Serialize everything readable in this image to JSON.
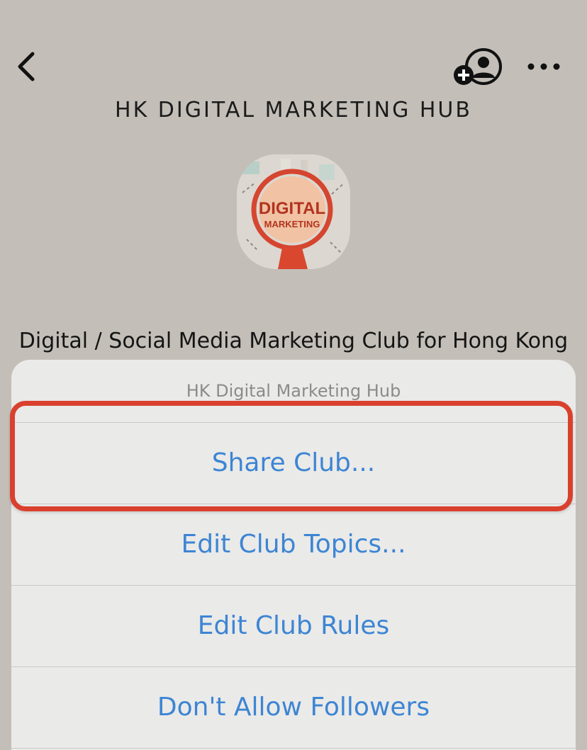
{
  "header": {
    "back_icon": "chevron-left-icon",
    "add_member_icon": "add-person-icon",
    "more_icon": "ellipsis-icon",
    "title": "HK DIGITAL MARKETING HUB"
  },
  "club": {
    "avatar_text_line1": "DIGITAL",
    "avatar_text_line2": "MARKETING",
    "description": "Digital / Social Media Marketing Club for Hong Kong"
  },
  "action_sheet": {
    "title": "HK Digital Marketing Hub",
    "options": [
      {
        "label": "Share Club..."
      },
      {
        "label": "Edit Club Topics..."
      },
      {
        "label": "Edit Club Rules"
      },
      {
        "label": "Don't Allow Followers"
      }
    ]
  },
  "colors": {
    "background": "#c3bfb8",
    "sheet": "#eaeae9",
    "action_blue": "#3d85d3",
    "highlight_red": "#d9412e"
  }
}
